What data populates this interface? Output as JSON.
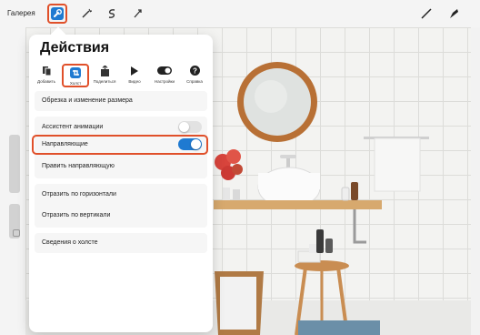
{
  "toolbar": {
    "gallery_label": "Галерея"
  },
  "panel": {
    "title": "Действия",
    "actions": [
      {
        "label": "Добавить",
        "icon": "add-icon"
      },
      {
        "label": "Холст",
        "icon": "canvas-icon"
      },
      {
        "label": "Поделиться",
        "icon": "share-icon"
      },
      {
        "label": "Видео",
        "icon": "video-icon"
      },
      {
        "label": "Настройки",
        "icon": "settings-toggle-icon"
      },
      {
        "label": "Справка",
        "icon": "help-icon"
      }
    ],
    "crop_label": "Обрезка и изменение размера",
    "animation_assist_label": "Ассистент анимации",
    "animation_assist_on": false,
    "guides_label": "Направляющие",
    "guides_on": true,
    "edit_guide_label": "Править направляющую",
    "flip_horizontal_label": "Отразить по горизонтали",
    "flip_vertical_label": "Отразить по вертикали",
    "canvas_info_label": "Сведения о холсте"
  },
  "colors": {
    "accent": "#1f7ad1",
    "highlight": "#e0502a"
  }
}
